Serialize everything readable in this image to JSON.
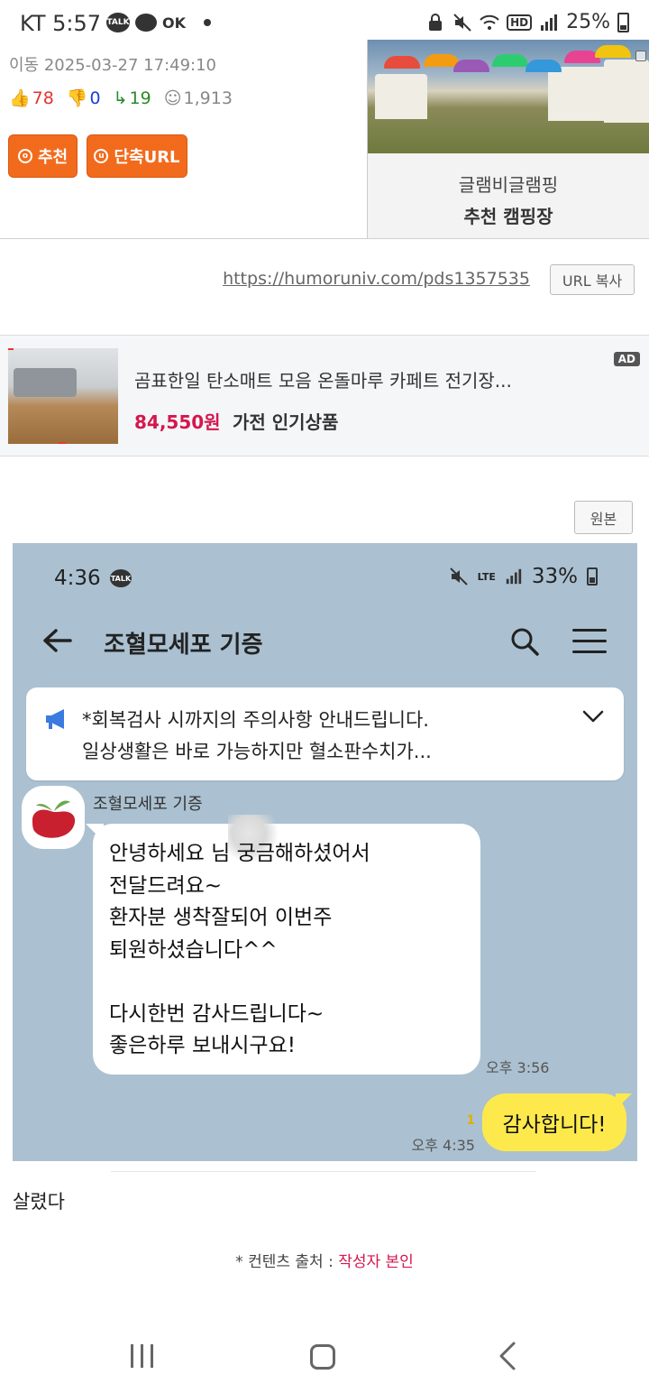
{
  "statusbar": {
    "carrier_time": "KT 5:57",
    "talk_badge": "TALK",
    "ok_label": "OK",
    "hd_label": "HD",
    "battery": "25%"
  },
  "post": {
    "meta": "이동 2025-03-27 17:49:10",
    "upvotes": "78",
    "downvotes": "0",
    "replies": "19",
    "views": "1,913",
    "recommend_label": "추천",
    "short_url_label": "단축URL"
  },
  "camp_ad": {
    "title": "글램비글램핑",
    "subtitle": "추천 캠핑장"
  },
  "url_bar": {
    "link": "https://humoruniv.com/pds1357535",
    "copy_label": "URL 복사"
  },
  "product_ad": {
    "title": "곰표한일 탄소매트 모음 온돌마루 카페트 전기장...",
    "price": "84,550원",
    "category": "가전 인기상품",
    "ad_badge": "AD"
  },
  "original_button": "원본",
  "screenshot": {
    "time": "4:36",
    "talk_badge": "TALK",
    "lte": "LTE",
    "battery": "33%",
    "chat_title": "조혈모세포 기증",
    "notice_line1": "*회복검사 시까지의 주의사항 안내드립니다.",
    "notice_line2": "일상생활은 바로 가능하지만 혈소판수치가...",
    "sender": "조혈모세포 기증",
    "incoming_message": "안녕하세요          님 궁금해하셨어서\n전달드려요~\n환자분 생착잘되어 이번주\n퇴원하셨습니다^^\n\n다시한번 감사드립니다~\n좋은하루 보내시구요!",
    "incoming_time": "오후 3:56",
    "outgoing_message": "감사합니다!",
    "unread_count": "1",
    "outgoing_time": "오후 4:35"
  },
  "body_text": "살렸다",
  "source": {
    "prefix": "* 컨텐츠 출처 : ",
    "author": "작성자 본인"
  }
}
